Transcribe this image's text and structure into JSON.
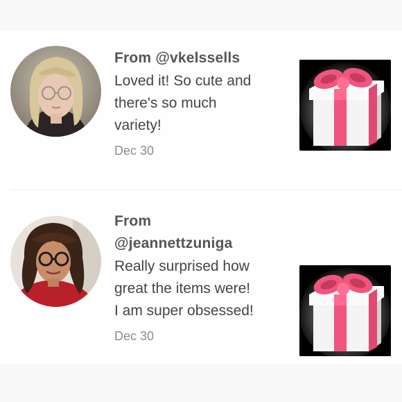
{
  "reviews": [
    {
      "from": "From @vkelssells",
      "comment_lines": [
        "Loved it! So cute and",
        "there's so much",
        "variety!"
      ],
      "date": "Dec 30",
      "avatar_icon": "reviewer-photo-blonde-glasses",
      "product_icon": "gift-box-icon"
    },
    {
      "from_lines": [
        "From",
        "@jeannettzuniga"
      ],
      "comment_lines": [
        "Really surprised how",
        "great the items were!",
        "I am super obsessed!"
      ],
      "date": "Dec 30",
      "avatar_icon": "reviewer-photo-curly-hair-glasses",
      "product_icon": "gift-box-icon"
    }
  ],
  "colors": {
    "ribbon": "#f0557d",
    "tile_bg": "#000000",
    "date_text": "#8c8c8c"
  }
}
